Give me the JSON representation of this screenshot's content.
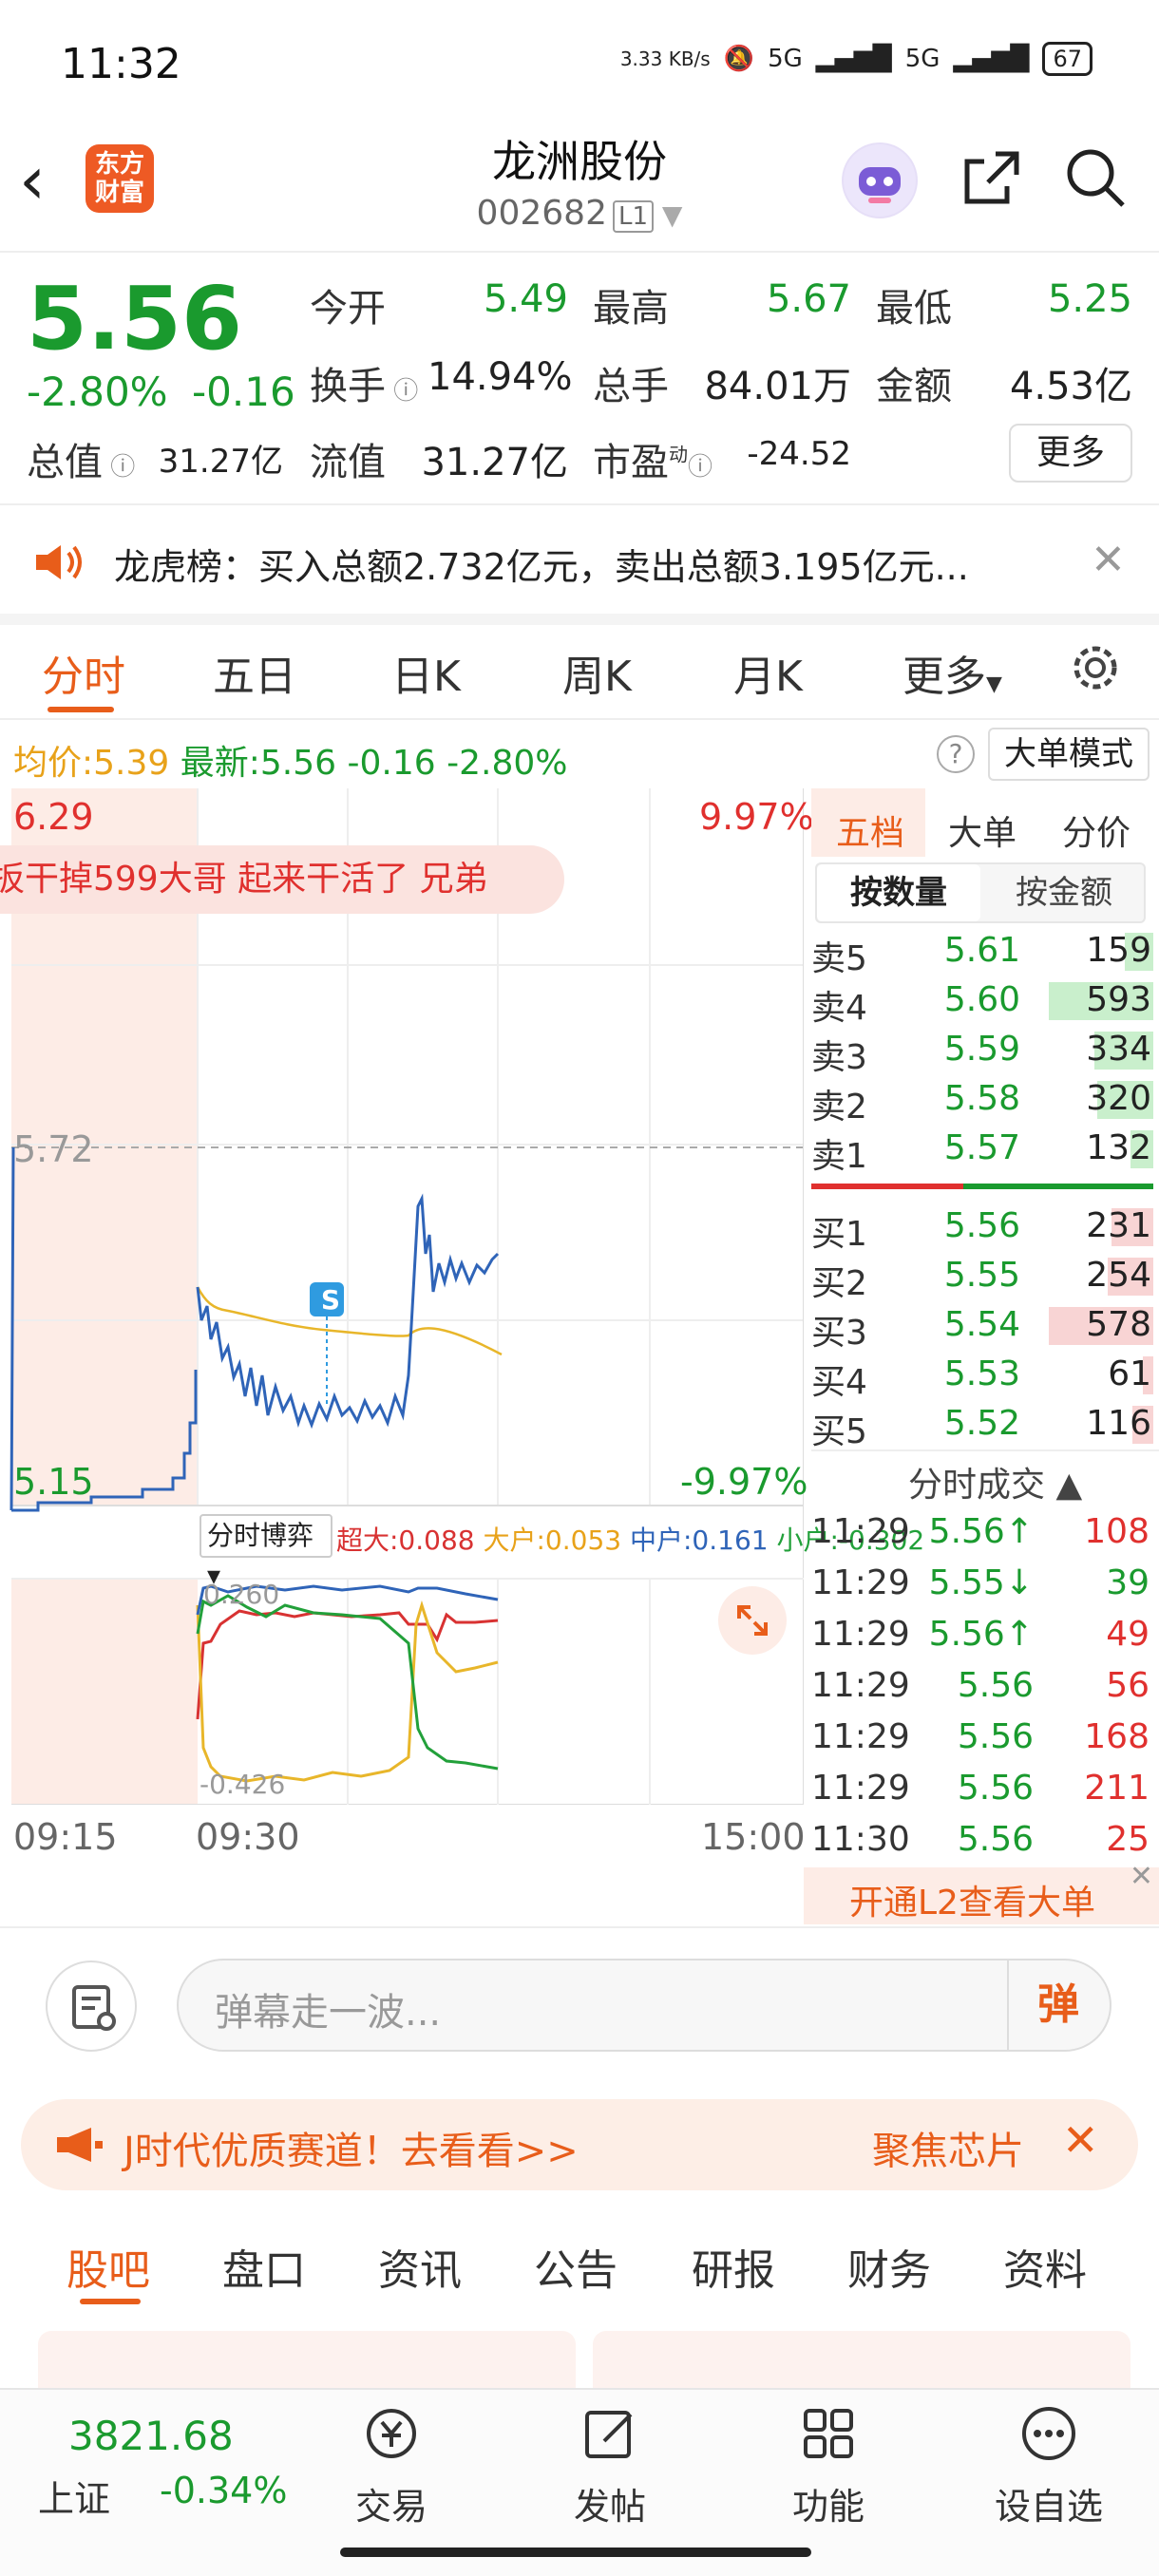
{
  "status_bar": {
    "time": "11:32",
    "net_speed": "3.33 KB/s",
    "signal1": "5G",
    "signal2": "5G",
    "battery": "67"
  },
  "header": {
    "logo_text": "东方财富",
    "stock_name": "龙洲股份",
    "stock_code": "002682",
    "level_badge": "L1"
  },
  "quote": {
    "price": "5.56",
    "change_pct": "-2.80%",
    "change": "-0.16",
    "open_label": "今开",
    "open": "5.49",
    "high_label": "最高",
    "high": "5.67",
    "low_label": "最低",
    "low": "5.25",
    "turnover_label": "换手",
    "turnover": "14.94%",
    "volume_label": "总手",
    "volume": "84.01万",
    "amount_label": "金额",
    "amount": "4.53亿",
    "mktcap_label": "总值",
    "mktcap": "31.27亿",
    "float_label": "流值",
    "float": "31.27亿",
    "pe_label": "市盈",
    "pe_sup": "动",
    "pe": "-24.52",
    "more_label": "更多"
  },
  "notice": {
    "text": "龙虎榜：买入总额2.732亿元，卖出总额3.195亿元..."
  },
  "chart_tabs": [
    "分时",
    "五日",
    "日K",
    "周K",
    "月K",
    "更多"
  ],
  "info_line": {
    "avg_label": "均价:",
    "avg": "5.39",
    "latest_label": "最新:",
    "latest": "5.56",
    "chg": "-0.16",
    "pct": "-2.80%",
    "mode_button": "大单模式"
  },
  "chart": {
    "y_top": "6.29",
    "y_top_pct": "9.97%",
    "y_mid": "5.72",
    "y_bottom": "5.15",
    "y_bottom_pct": "-9.97%",
    "danmaku": "扳干掉599大哥 起来干活了 兄弟",
    "marker": "S",
    "indicator_select": "分时博弈",
    "ind_super": "超大:0.088",
    "ind_large": "大户:0.053",
    "ind_mid": "中户:0.161",
    "ind_small": "小户:-0.302",
    "sub_top": "0.260",
    "sub_bottom": "-0.426",
    "time_start": "09:15",
    "time_open": "09:30",
    "time_end": "15:00"
  },
  "order_book": {
    "tabs": [
      "五档",
      "大单",
      "分价"
    ],
    "sub_tabs": [
      "按数量",
      "按金额"
    ],
    "asks": [
      {
        "name": "卖5",
        "price": "5.61",
        "vol": "159",
        "ratio": 0.27
      },
      {
        "name": "卖4",
        "price": "5.60",
        "vol": "593",
        "ratio": 1.0
      },
      {
        "name": "卖3",
        "price": "5.59",
        "vol": "334",
        "ratio": 0.56
      },
      {
        "name": "卖2",
        "price": "5.58",
        "vol": "320",
        "ratio": 0.54
      },
      {
        "name": "卖1",
        "price": "5.57",
        "vol": "132",
        "ratio": 0.22
      }
    ],
    "bids": [
      {
        "name": "买1",
        "price": "5.56",
        "vol": "231",
        "ratio": 0.4
      },
      {
        "name": "买2",
        "price": "5.55",
        "vol": "254",
        "ratio": 0.44
      },
      {
        "name": "买3",
        "price": "5.54",
        "vol": "578",
        "ratio": 1.0
      },
      {
        "name": "买4",
        "price": "5.53",
        "vol": "61",
        "ratio": 0.1
      },
      {
        "name": "买5",
        "price": "5.52",
        "vol": "116",
        "ratio": 0.2
      }
    ],
    "trades_title": "分时成交",
    "trades": [
      {
        "time": "11:29",
        "price": "5.56↑",
        "vol": "108"
      },
      {
        "time": "11:29",
        "price": "5.55↓",
        "vol": "39"
      },
      {
        "time": "11:29",
        "price": "5.56↑",
        "vol": "49"
      },
      {
        "time": "11:29",
        "price": "5.56",
        "vol": "56"
      },
      {
        "time": "11:29",
        "price": "5.56",
        "vol": "168"
      },
      {
        "time": "11:29",
        "price": "5.56",
        "vol": "211"
      },
      {
        "time": "11:30",
        "price": "5.56",
        "vol": "25"
      }
    ],
    "l2_banner": "开通L2查看大单"
  },
  "danmu": {
    "placeholder": "弹幕走一波...",
    "send_label": "弹"
  },
  "promo": {
    "text": "J时代优质赛道！去看看>>",
    "right": "聚焦芯片"
  },
  "bottom_tabs": [
    "股吧",
    "盘口",
    "资讯",
    "公告",
    "研报",
    "财务",
    "资料"
  ],
  "index": {
    "value": "3821.68",
    "name": "上证",
    "pct": "-0.34%"
  },
  "nav": [
    "交易",
    "发帖",
    "功能",
    "设自选"
  ],
  "colors": {
    "accent": "#e85d1a",
    "down": "#1a9a2e",
    "up": "#e0302e"
  }
}
